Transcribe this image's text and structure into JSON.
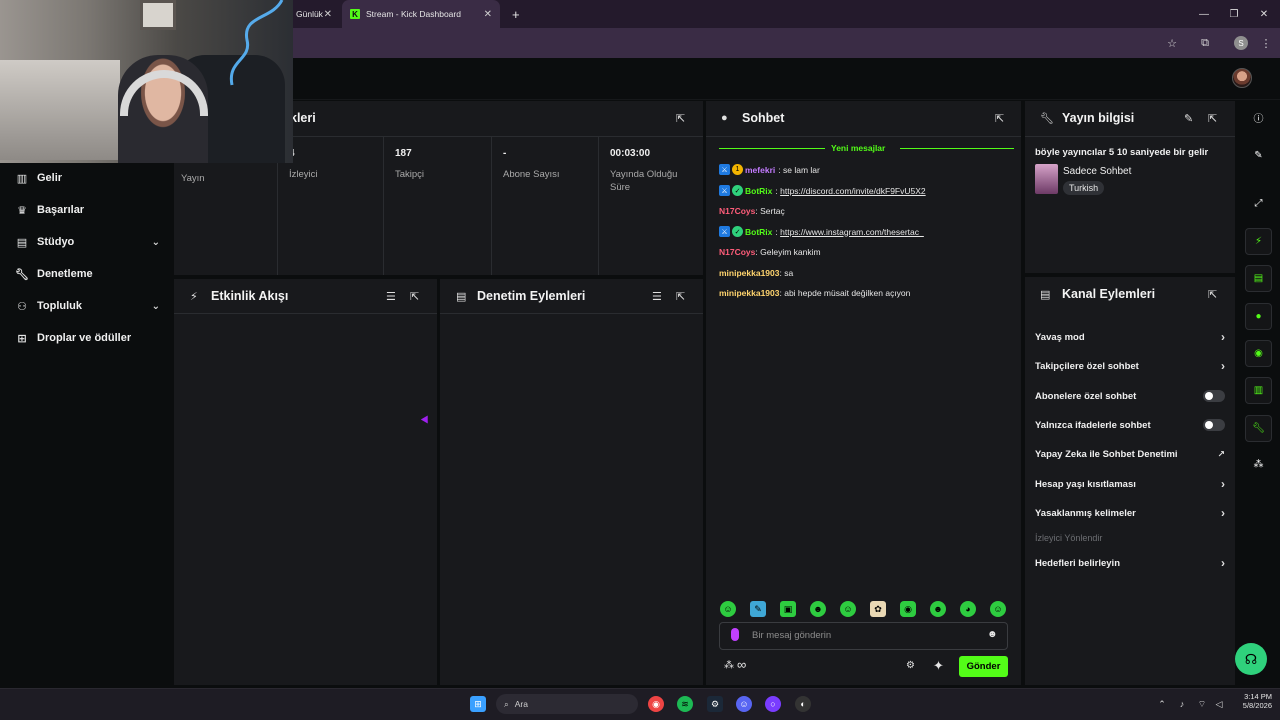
{
  "browser": {
    "tabs": [
      {
        "label": "Günlük",
        "active": false
      },
      {
        "label": "Stream - Kick Dashboard",
        "active": true
      }
    ],
    "new_tab": "+",
    "close": "✕",
    "profile_initial": "S"
  },
  "sidebar": {
    "items": [
      {
        "label": "Gelir",
        "icon": "bar-chart-icon",
        "has_chevron": false
      },
      {
        "label": "Başarılar",
        "icon": "trophy-icon",
        "has_chevron": false
      },
      {
        "label": "Stüdyo",
        "icon": "layout-icon",
        "has_chevron": true
      },
      {
        "label": "Denetleme",
        "icon": "wrench-icon",
        "has_chevron": false
      },
      {
        "label": "Topluluk",
        "icon": "users-icon",
        "has_chevron": true
      },
      {
        "label": "Droplar ve ödüller",
        "icon": "gift-icon",
        "has_chevron": false
      }
    ]
  },
  "stats_panel": {
    "title_partial": "kleri",
    "stats": [
      {
        "value": "",
        "label": "Yayın"
      },
      {
        "value": "4",
        "label": "İzleyici"
      },
      {
        "value": "187",
        "label": "Takipçi"
      },
      {
        "value": "-",
        "label": "Abone Sayısı"
      },
      {
        "value": "00:03:00",
        "label": "Yayında Olduğu Süre"
      }
    ]
  },
  "activity_panel": {
    "title": "Etkinlik Akışı"
  },
  "moderation_panel": {
    "title": "Denetim Eylemleri"
  },
  "chat": {
    "title": "Sohbet",
    "new_messages": "Yeni mesajlar",
    "messages": [
      {
        "user": "mefekri",
        "text": "se lam lar",
        "user_color": "#c37bff",
        "badges": [
          "blue",
          "gold"
        ],
        "link": false
      },
      {
        "user": "BotRix",
        "text": "https://discord.com/invite/dkF9FvU5X2",
        "user_color": "#53fc18",
        "badges": [
          "blue",
          "green"
        ],
        "link": true
      },
      {
        "user": "N17Coys",
        "text": "Sertaç",
        "user_color": "#ff5d7a",
        "badges": [],
        "link": false
      },
      {
        "user": "BotRix",
        "text": "https://www.instagram.com/thesertac_",
        "user_color": "#53fc18",
        "badges": [
          "blue",
          "green"
        ],
        "link": true
      },
      {
        "user": "N17Coys",
        "text": "Geleyim kankim",
        "user_color": "#ff5d7a",
        "badges": [],
        "link": false
      },
      {
        "user": "minipekka1903",
        "text": "sa",
        "user_color": "#ffd46e",
        "badges": [],
        "link": false
      },
      {
        "user": "minipekka1903",
        "text": "abi hepde müsait değilken açıyon",
        "user_color": "#ffd46e",
        "badges": [],
        "link": false
      }
    ],
    "input_placeholder": "Bir mesaj gönderin",
    "send_label": "Gönder",
    "infinity": "∞"
  },
  "stream_info": {
    "title": "Yayın bilgisi",
    "stream_title": "böyle yayıncılar 5 10 saniyede bir gelir",
    "category": "Sadece Sohbet",
    "tag": "Turkish"
  },
  "channel_actions": {
    "title": "Kanal Eylemleri",
    "rows": [
      {
        "label": "Yavaş mod",
        "control": "chevron"
      },
      {
        "label": "Takipçilere özel sohbet",
        "control": "chevron"
      },
      {
        "label": "Abonelere özel sohbet",
        "control": "toggle",
        "on": false
      },
      {
        "label": "Yalnızca ifadelerle sohbet",
        "control": "toggle",
        "on": false
      },
      {
        "label": "Yapay Zeka ile Sohbet Denetimi",
        "control": "external"
      },
      {
        "label": "Hesap yaşı kısıtlaması",
        "control": "chevron"
      },
      {
        "label": "Yasaklanmış kelimeler",
        "control": "chevron"
      }
    ],
    "section_label": "İzleyici Yönlendir",
    "goal_row": "Hedefleri belirleyin"
  },
  "taskbar": {
    "search_label": "Ara",
    "time": "3:14 PM",
    "date": "5/8/2026"
  },
  "colors": {
    "accent": "#53fc18",
    "panel": "#18191c",
    "background": "#0b0d0e"
  }
}
